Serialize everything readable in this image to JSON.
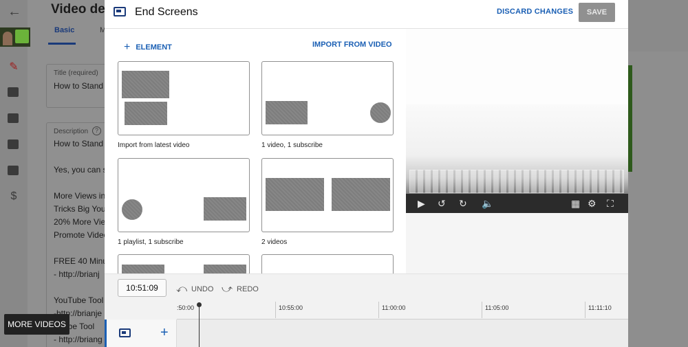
{
  "background": {
    "page_title": "Video det",
    "tabs": [
      {
        "label": "Basic"
      },
      {
        "label": "M"
      }
    ],
    "title_field": {
      "label": "Title (required)",
      "value": "How to Stand"
    },
    "description_field": {
      "label": "Description",
      "help_icon": "help-circle-icon",
      "lines": [
        "How to Stand",
        "",
        "Yes, you can s",
        "",
        "More Views in",
        "Tricks Big You",
        "20% More View",
        "Promote Video",
        "",
        "FREE 40 Minut",
        "- http://brianj",
        "",
        "YouTube Tool",
        "-http://brianje",
        "- Tube Tool",
        "- http://briang"
      ]
    },
    "rail_icons": [
      "back-arrow-icon",
      "pencil-icon",
      "analytics-icon",
      "editor-icon",
      "comments-icon",
      "subtitles-icon",
      "monetization-icon"
    ],
    "more_videos_label": "MORE VIDEOS"
  },
  "modal": {
    "header": {
      "icon": "end-screen-icon",
      "title": "End Screens",
      "discard_label": "DISCARD CHANGES",
      "save_label": "SAVE"
    },
    "actions": {
      "element_label": "ELEMENT",
      "import_label": "IMPORT FROM VIDEO"
    },
    "templates": [
      {
        "label": "Import from latest video"
      },
      {
        "label": "1 video, 1 subscribe"
      },
      {
        "label": "1 playlist, 1 subscribe"
      },
      {
        "label": "2 videos"
      }
    ],
    "player_controls": [
      "play-icon",
      "replay-10-icon",
      "forward-10-icon",
      "volume-icon",
      "grid-icon",
      "settings-icon",
      "fullscreen-icon"
    ],
    "timeline": {
      "current_time": "10:51:09",
      "undo_label": "UNDO",
      "redo_label": "REDO",
      "ticks": [
        ":50:00",
        "10:55:00",
        "11:00:00",
        "11:05:00",
        "11:11:10"
      ]
    }
  },
  "colors": {
    "accent_blue": "#1a5fb4",
    "dark_blue": "#1a3a7a",
    "save_disabled": "#909090",
    "overlay_gray": "#8c8c8c"
  }
}
